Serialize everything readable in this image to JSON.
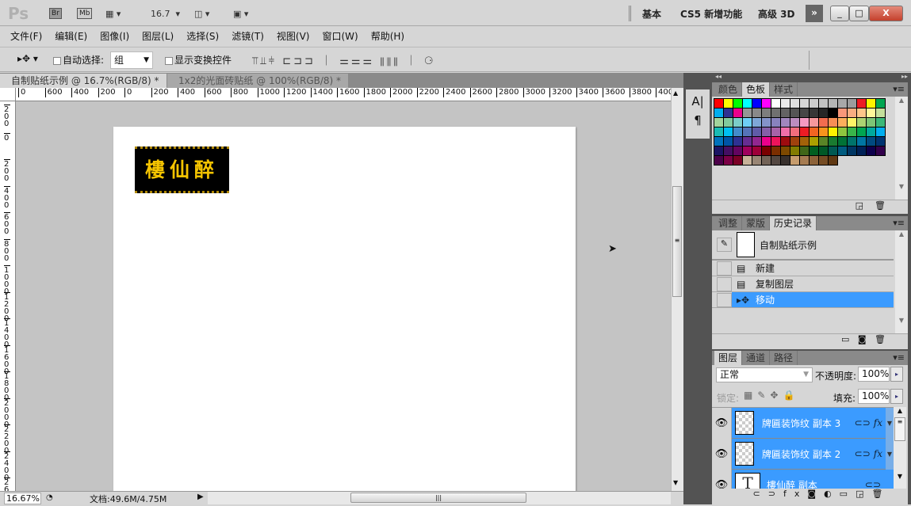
{
  "titlebar": {
    "logo": "Ps",
    "br": "Br",
    "mb": "Mb",
    "zoom": "16.7",
    "workspaces": [
      "基本",
      "CS5 新增功能",
      "高级 3D"
    ],
    "more": "»",
    "minimize": "_",
    "restore": "□",
    "close": "X"
  },
  "menu": [
    "文件(F)",
    "编辑(E)",
    "图像(I)",
    "图层(L)",
    "选择(S)",
    "滤镜(T)",
    "视图(V)",
    "窗口(W)",
    "帮助(H)"
  ],
  "options": {
    "auto_select_label": "自动选择:",
    "auto_select_value": "组",
    "show_transform_label": "显示变换控件",
    "auto_select_checked": false,
    "show_transform_checked": false
  },
  "doc_tabs": [
    {
      "label": "自制贴纸示例 @ 16.7%(RGB/8) *",
      "active": true
    },
    {
      "label": "1x2的光面砖贴纸 @ 100%(RGB/8) *",
      "active": false
    }
  ],
  "ruler_h": [
    "0",
    "600",
    "400",
    "200",
    "0",
    "200",
    "400",
    "600",
    "800",
    "1000",
    "1200",
    "1400",
    "1600",
    "1800",
    "2000",
    "2200",
    "2400",
    "2600",
    "2800",
    "3000",
    "3200",
    "3400",
    "3600",
    "3800",
    "4000"
  ],
  "ruler_v": [
    "200",
    "0",
    "200",
    "400",
    "600",
    "800",
    "1000",
    "1200",
    "1400",
    "1600",
    "1800",
    "2000",
    "2200",
    "2400",
    "26"
  ],
  "document": {
    "plaque_text": "樓仙醉"
  },
  "status": {
    "zoom": "16.67%",
    "doc_info": "文档:49.6M/4.75M"
  },
  "side_tools": {
    "char": "A|",
    "para": "¶"
  },
  "swatch_panel": {
    "tabs": [
      "颜色",
      "色板",
      "样式"
    ],
    "active": "色板",
    "colors": [
      [
        "#ff0000",
        "#ffff00",
        "#00ff00",
        "#00ffff",
        "#0000ff",
        "#ff00ff",
        "#ffffff",
        "#ebebeb",
        "#e0e0e0",
        "#d6d6d6",
        "#cccccc",
        "#c2c2c2",
        "#b5b5b5",
        "#a8a8a8",
        "#9c9c9c",
        "#ed1c24",
        "#fff200"
      ],
      [
        "#00a651",
        "#00aeef",
        "#2e3192",
        "#ec008c",
        "#959595",
        "#898989",
        "#7d7d7d",
        "#707070",
        "#636363",
        "#555555",
        "#464646",
        "#363636",
        "#262626",
        "#000000",
        "#f7977a",
        "#f9ad81",
        "#fdc68a",
        "#fff79a"
      ],
      [
        "#c4df9b",
        "#a3d39c",
        "#82ca9d",
        "#7bcdc8",
        "#6ecff6",
        "#7ea7d8",
        "#8493ca",
        "#8882be",
        "#a187be",
        "#bc8dbf",
        "#f49ac2",
        "#f6989d",
        "#f26c4f",
        "#f68e55",
        "#fbaf5c",
        "#fff467",
        "#acd372",
        "#7cc576"
      ],
      [
        "#3bb878",
        "#1abbb4",
        "#00bff3",
        "#438ccb",
        "#5574b9",
        "#605ca8",
        "#855fa8",
        "#a763a8",
        "#f06ea9",
        "#f26d7d",
        "#ed1c24",
        "#f26522",
        "#f7941d",
        "#fff200",
        "#8dc63f",
        "#39b54a",
        "#00a651",
        "#00a99d"
      ],
      [
        "#00aeef",
        "#0072bc",
        "#0054a6",
        "#2e3192",
        "#662d91",
        "#92278f",
        "#ec008c",
        "#ed145b",
        "#9e0b0f",
        "#a0410d",
        "#a36209",
        "#aba000",
        "#598527",
        "#197b30",
        "#007236",
        "#00746b",
        "#0076a3",
        "#004a80"
      ],
      [
        "#003471",
        "#1b1464",
        "#440e62",
        "#630460",
        "#9e005d",
        "#9e0039",
        "#790000",
        "#7b2e00",
        "#7d4900",
        "#827b00",
        "#406618",
        "#005e20",
        "#005826",
        "#005952",
        "#005b7f",
        "#003663",
        "#002157",
        "#0d004c"
      ],
      [
        "#32004b",
        "#4b0049",
        "#7b0046",
        "#7a0026",
        "#c7b299",
        "#998675",
        "#736357",
        "#534741",
        "#37302d",
        "#c69c6d",
        "#a67c52",
        "#8c6239",
        "#754c24",
        "#603913"
      ]
    ]
  },
  "history_panel": {
    "tabs": [
      "调整",
      "蒙版",
      "历史记录"
    ],
    "active": "历史记录",
    "snapshot": "自制贴纸示例",
    "items": [
      "新建",
      "复制图层",
      "移动"
    ],
    "selected": "移动"
  },
  "layers_panel": {
    "tabs": [
      "图层",
      "通道",
      "路径"
    ],
    "active": "图层",
    "blend_mode": "正常",
    "opacity_label": "不透明度:",
    "opacity": "100%",
    "lock_label": "锁定:",
    "fill_label": "填充:",
    "fill": "100%",
    "layers": [
      {
        "name": "牌匾装饰纹 副本 3",
        "type": "pixel",
        "fx": true
      },
      {
        "name": "牌匾装饰纹 副本 2",
        "type": "pixel",
        "fx": true
      },
      {
        "name": "樓仙醉 副本",
        "type": "text",
        "fx": false
      }
    ],
    "text_thumb": "T",
    "fx_label": "fx"
  },
  "colors": {
    "selection": "#3b9bff",
    "panel": "#d6d6d6",
    "dark": "#535353"
  }
}
